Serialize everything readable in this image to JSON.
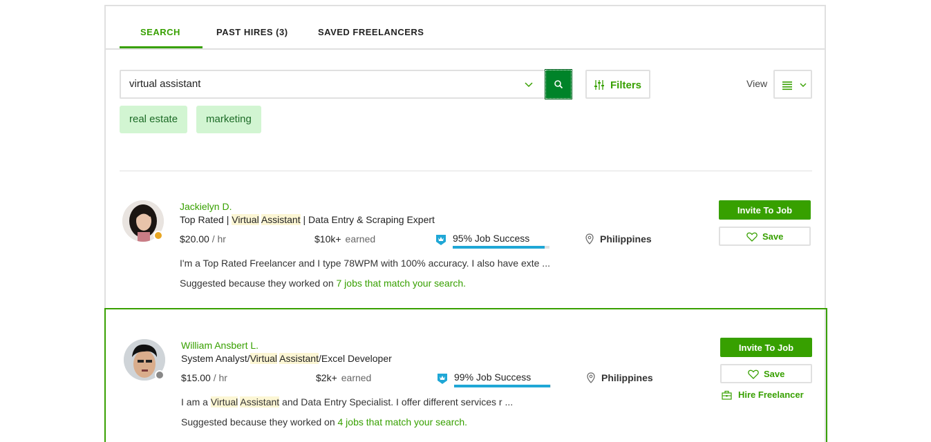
{
  "tabs": [
    {
      "label": "SEARCH",
      "active": true
    },
    {
      "label": "PAST HIRES (3)",
      "active": false
    },
    {
      "label": "SAVED FREELANCERS",
      "active": false
    }
  ],
  "search": {
    "value": "virtual assistant",
    "button_icon": "search-icon",
    "dropdown_icon": "chevron-down-icon"
  },
  "filters": {
    "label": "Filters",
    "icon": "sliders-icon"
  },
  "view": {
    "label": "View",
    "icon": "list-view-icon"
  },
  "chips": [
    "real estate",
    "marketing"
  ],
  "colors": {
    "brand_green": "#37a000",
    "search_button": "#008329",
    "chip_bg": "#d2f5d2",
    "job_success_bar": "#1fa7d6",
    "highlight": "#fcf6d4",
    "status_away": "#e8a623",
    "status_offline": "#888888"
  },
  "freelancers": [
    {
      "name": "Jackielyn D.",
      "title_parts": [
        "Top Rated | ",
        "Virtual",
        " ",
        "Assistant",
        " | Data Entry & Scraping Expert"
      ],
      "rate": "$20.00",
      "rate_unit": "/ hr",
      "earned": "$10k+",
      "earned_label": "earned",
      "job_success": "95% Job Success",
      "job_success_pct": 95,
      "location": "Philippines",
      "description": "I'm a Top Rated Freelancer and I type 78WPM with 100% accuracy. I also have exte ...",
      "suggest_prefix": "Suggested because they worked on ",
      "suggest_link": "7 jobs that match your search.",
      "status": "away",
      "invite_label": "Invite To Job",
      "save_label": "Save"
    },
    {
      "name": "William Ansbert L.",
      "title_parts": [
        "System Analyst/",
        "Virtual",
        " ",
        "Assistant",
        "/Excel Developer"
      ],
      "rate": "$15.00",
      "rate_unit": "/ hr",
      "earned": "$2k+",
      "earned_label": "earned",
      "job_success": "99% Job Success",
      "job_success_pct": 99,
      "location": "Philippines",
      "description_parts": [
        "I am a ",
        "Virtual",
        " ",
        "Assistant",
        " and Data Entry Specialist. I offer different services r ..."
      ],
      "suggest_prefix": "Suggested because they worked on ",
      "suggest_link": "4 jobs that match your search.",
      "status": "offline",
      "invite_label": "Invite To Job",
      "save_label": "Save",
      "hire_label": "Hire Freelancer"
    }
  ]
}
